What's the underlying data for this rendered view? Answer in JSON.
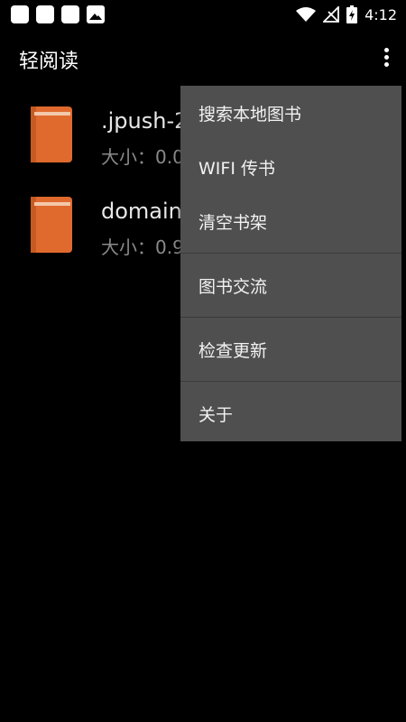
{
  "status_bar": {
    "time": "4:12",
    "left_icons": [
      "notification-square-icon",
      "notification-square-icon",
      "notification-square-icon",
      "image-notification-icon"
    ],
    "right_icons": [
      "wifi-icon",
      "no-signal-icon",
      "battery-charging-icon"
    ]
  },
  "app_bar": {
    "title": "轻阅读",
    "overflow_icon": "more-vert-icon"
  },
  "books": [
    {
      "name": ".jpush-2",
      "size": "大小：0.0",
      "icon": "book-icon",
      "color": "#e06a2e"
    },
    {
      "name": "domain",
      "size": "大小：0.9",
      "icon": "book-icon",
      "color": "#e06a2e"
    }
  ],
  "menu": {
    "items": [
      "搜索本地图书",
      "WIFI 传书",
      "清空书架",
      "图书交流",
      "检查更新",
      "关于"
    ]
  }
}
